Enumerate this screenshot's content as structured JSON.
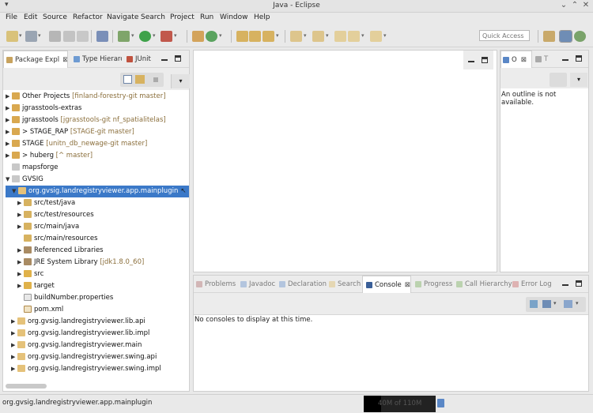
{
  "window": {
    "title": "Java - Eclipse"
  },
  "menu": [
    "File",
    "Edit",
    "Source",
    "Refactor",
    "Navigate",
    "Search",
    "Project",
    "Run",
    "Window",
    "Help"
  ],
  "quick_access": {
    "placeholder": "Quick Access"
  },
  "left_panel": {
    "tabs": [
      "Package Expl",
      "Type Hierarc",
      "JUnit"
    ],
    "tree": [
      {
        "label": "Other Projects",
        "decoration": "[finland-forestry-git master]"
      },
      {
        "label": "jgrasstools-extras",
        "decoration": ""
      },
      {
        "label": "jgrasstools",
        "decoration": "[jgrasstools-git nf_spatialitelas]"
      },
      {
        "label": "> STAGE_RAP",
        "decoration": "[STAGE-git master]"
      },
      {
        "label": "STAGE",
        "decoration": "[unitn_db_newage-git master]"
      },
      {
        "label": "> huberg",
        "decoration": "[^ master]"
      },
      {
        "label": "mapsforge",
        "decoration": ""
      },
      {
        "label": "GVSIG",
        "decoration": ""
      },
      {
        "label": "org.gvsig.landregistryviewer.app.mainplugin",
        "decoration": ""
      },
      {
        "label": "src/test/java",
        "decoration": ""
      },
      {
        "label": "src/test/resources",
        "decoration": ""
      },
      {
        "label": "src/main/java",
        "decoration": ""
      },
      {
        "label": "src/main/resources",
        "decoration": ""
      },
      {
        "label": "Referenced Libraries",
        "decoration": ""
      },
      {
        "label": "JRE System Library",
        "decoration": "[jdk1.8.0_60]"
      },
      {
        "label": "src",
        "decoration": ""
      },
      {
        "label": "target",
        "decoration": ""
      },
      {
        "label": "buildNumber.properties",
        "decoration": ""
      },
      {
        "label": "pom.xml",
        "decoration": ""
      },
      {
        "label": "org.gvsig.landregistryviewer.lib.api",
        "decoration": ""
      },
      {
        "label": "org.gvsig.landregistryviewer.lib.impl",
        "decoration": ""
      },
      {
        "label": "org.gvsig.landregistryviewer.main",
        "decoration": ""
      },
      {
        "label": "org.gvsig.landregistryviewer.swing.api",
        "decoration": ""
      },
      {
        "label": "org.gvsig.landregistryviewer.swing.impl",
        "decoration": ""
      }
    ]
  },
  "outline_panel": {
    "tabs": [
      "O",
      "T"
    ],
    "message": "An outline is not available."
  },
  "bottom_panel": {
    "tabs": [
      "Problems",
      "Javadoc",
      "Declaration",
      "Search",
      "Console",
      "Progress",
      "Call Hierarchy",
      "Error Log"
    ],
    "message": "No consoles to display at this time."
  },
  "status": {
    "selection": "org.gvsig.landregistryviewer.app.mainplugin",
    "heap": "40M of 110M"
  },
  "colors": {
    "selection": "#3b79c8",
    "decoration": "#8b6f3c",
    "folder": "#e0b24a",
    "java": "#7a5fb1"
  }
}
